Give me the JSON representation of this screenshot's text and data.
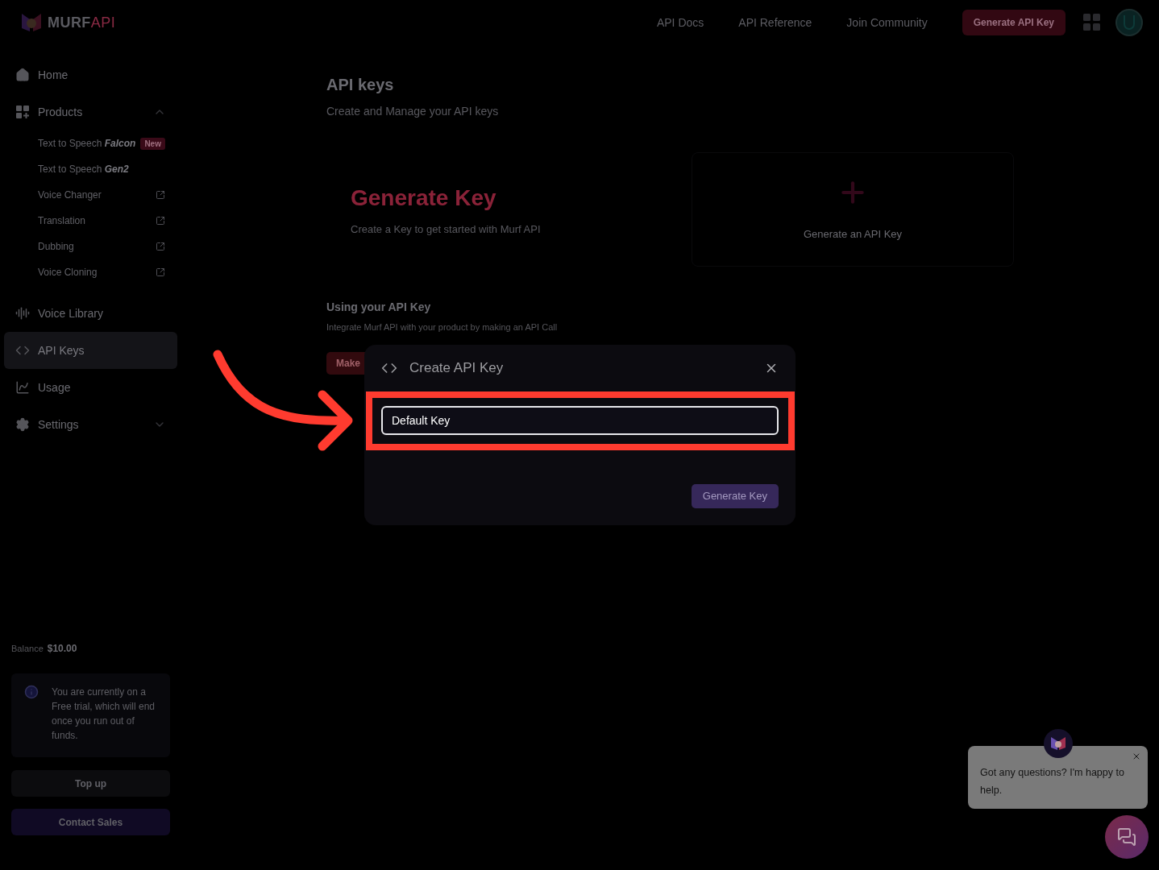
{
  "header": {
    "logo": {
      "brand": "MURF",
      "suffix": "API"
    },
    "links": [
      "API Docs",
      "API Reference",
      "Join Community"
    ],
    "cta": "Generate API Key"
  },
  "sidebar": {
    "items": [
      {
        "label": "Home",
        "selected": false
      },
      {
        "label": "Products",
        "selected": false,
        "expanded": true,
        "children": [
          {
            "label": "Text to Speech **Falcon**",
            "badge": "New",
            "external": false
          },
          {
            "label": "Text to Speech **Gen2**",
            "external": false
          },
          {
            "label": "Voice Changer",
            "external": true
          },
          {
            "label": "Translation",
            "external": true
          },
          {
            "label": "Dubbing",
            "external": true
          },
          {
            "label": "Voice Cloning",
            "external": true
          }
        ]
      },
      {
        "label": "Voice Library",
        "selected": false
      },
      {
        "label": "API Keys",
        "selected": true
      },
      {
        "label": "Usage",
        "selected": false
      },
      {
        "label": "Settings",
        "selected": false,
        "expanded": false
      }
    ],
    "balance": {
      "label": "Balance",
      "value": "$10.00"
    },
    "notice": "You are currently on a Free trial, which will end once you run out of funds.",
    "buttons": [
      {
        "label": "Top up",
        "kind": "secondary"
      },
      {
        "label": "Contact Sales",
        "kind": "primary"
      }
    ]
  },
  "main": {
    "title": "API keys",
    "subtitle": "Create and Manage your API keys",
    "generate_card": {
      "title": "Generate Key",
      "subtitle": "Create a Key to get started with Murf API",
      "action": "Generate an API Key"
    },
    "usage": {
      "title": "Using your API Key",
      "text": "Integrate Murf API with your product by making an API Call",
      "button": "Make"
    }
  },
  "modal": {
    "title": "Create API Key",
    "field_value": "Default Key",
    "button": "Generate Key"
  },
  "chat": {
    "message": "Got any questions? I'm happy to help."
  }
}
